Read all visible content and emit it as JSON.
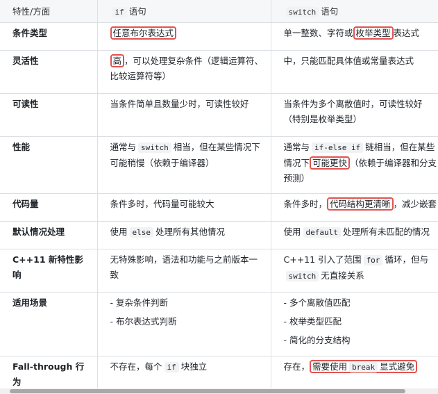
{
  "header": {
    "col1": "特性/方面",
    "col2_code": "if",
    "col2_label": "语句",
    "col3_code": "switch",
    "col3_label": "语句"
  },
  "rows": [
    {
      "name": "条件类型",
      "if_text": "任意布尔表达式",
      "sw_a": "单一整数、字符或",
      "sw_hl": "枚举类型",
      "sw_b": "表达式"
    },
    {
      "name": "灵活性",
      "if_hl": "高",
      "if_a": "，可以处理复杂条件（逻辑运算符、",
      "if_b": "比较运算符等）",
      "sw": "中，只能匹配具体值或常量表达式"
    },
    {
      "name": "可读性",
      "if_text": "当条件简单且数量少时，可读性较好",
      "sw_a": "当条件为多个离散值时，可读性较好",
      "sw_b": "（特别是枚举类型）"
    },
    {
      "name": "性能",
      "if_a": "通常与",
      "if_code": "switch",
      "if_b": "相当，但在某些情况下",
      "if_c": "可能稍慢（依赖于编译器）",
      "sw_a": "通常与",
      "sw_code": "if-else if",
      "sw_b": "链相当，但在某些",
      "sw_c": "情况下",
      "sw_hl": "可能更快",
      "sw_d": "（依赖于编译器和分支",
      "sw_e": "预测）"
    },
    {
      "name": "代码量",
      "if_text": "条件多时，代码量可能较大",
      "sw_a": "条件多时，",
      "sw_hl": "代码结构更清晰",
      "sw_b": "，减少嵌套"
    },
    {
      "name": "默认情况处理",
      "if_a": "使用",
      "if_code": "else",
      "if_b": "处理所有其他情况",
      "sw_a": "使用",
      "sw_code": "default",
      "sw_b": "处理所有未匹配的情况"
    },
    {
      "name": "C++11 新特性影响",
      "if_a": "无特殊影响，语法和功能与之前版本一",
      "if_b": "致",
      "sw_a": "C++11 引入了范围",
      "sw_code1": "for",
      "sw_b": "循环，但与",
      "sw_code2": "switch",
      "sw_c": "无直接关系"
    },
    {
      "name": "适用场景",
      "if_items": [
        "- 复杂条件判断",
        "- 布尔表达式判断"
      ],
      "sw_items": [
        "- 多个离散值匹配",
        "- 枚举类型匹配",
        "- 简化的分支结构"
      ]
    },
    {
      "name": "Fall-through 行为",
      "if_a": "不存在，每个",
      "if_code": "if",
      "if_b": "块独立",
      "sw_a": "存在，",
      "sw_hl_a": "需要使用",
      "sw_code": "break",
      "sw_hl_b": "显式避免"
    }
  ],
  "colors": {
    "highlight": "#e2524f",
    "header_bg": "#f6f7f9",
    "border": "#dcdfe3"
  }
}
